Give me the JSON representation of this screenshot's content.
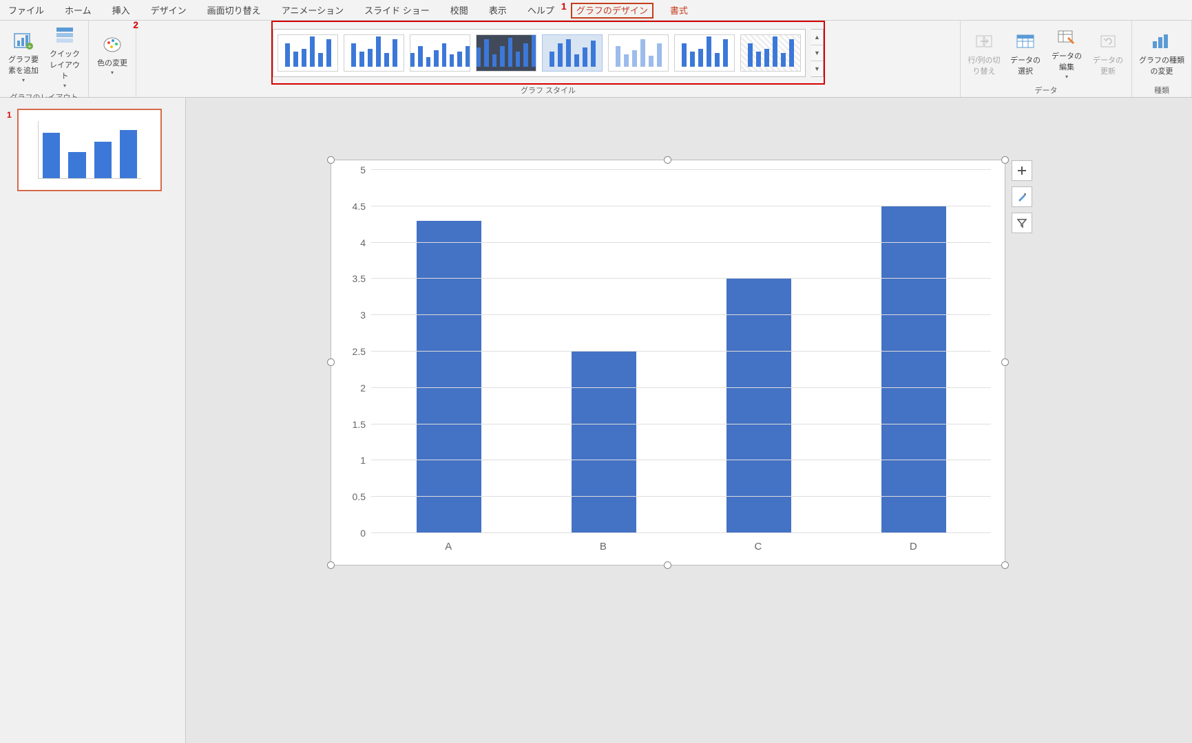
{
  "tabs": {
    "file": "ファイル",
    "home": "ホーム",
    "insert": "挿入",
    "design": "デザイン",
    "transitions": "画面切り替え",
    "animations": "アニメーション",
    "slideshow": "スライド ショー",
    "review": "校閲",
    "view": "表示",
    "help": "ヘルプ",
    "chart_design": "グラフのデザイン",
    "format": "書式"
  },
  "annotations": {
    "one": "1",
    "two": "2"
  },
  "ribbon": {
    "layout": {
      "add_element": "グラフ要素を追加",
      "quick_layout": "クイックレイアウト",
      "group_label": "グラフのレイアウト"
    },
    "colors": {
      "change_colors": "色の変更"
    },
    "styles": {
      "group_label": "グラフ スタイル"
    },
    "data": {
      "switch": "行/列の切り替え",
      "select": "データの選択",
      "edit": "データの編集",
      "refresh": "データの更新",
      "group_label": "データ"
    },
    "type": {
      "change_type": "グラフの種類の変更",
      "group_label": "種類"
    }
  },
  "thumbs": {
    "slide1": "1"
  },
  "chart_data": {
    "type": "bar",
    "categories": [
      "A",
      "B",
      "C",
      "D"
    ],
    "values": [
      4.3,
      2.5,
      3.5,
      4.5
    ],
    "ylim": [
      0,
      5
    ],
    "ystep": 0.5,
    "yticks": [
      "0",
      "0.5",
      "1",
      "1.5",
      "2",
      "2.5",
      "3",
      "3.5",
      "4",
      "4.5",
      "5"
    ],
    "title": "",
    "xlabel": "",
    "ylabel": ""
  },
  "gallery": {
    "styles": [
      {
        "bars": [
          34,
          22,
          26,
          44,
          20,
          40
        ]
      },
      {
        "bars": [
          34,
          22,
          26,
          44,
          20,
          40
        ]
      },
      {
        "bars": [
          20,
          30,
          14,
          24,
          34,
          18,
          22,
          30
        ]
      },
      {
        "bars": [
          28,
          40,
          18,
          30,
          42,
          22,
          34,
          46
        ],
        "dark": true
      },
      {
        "bars": [
          22,
          34,
          40,
          18,
          28,
          38
        ],
        "sel": true
      },
      {
        "bars": [
          30,
          18,
          24,
          40,
          16,
          34
        ],
        "faded": true
      },
      {
        "bars": [
          34,
          22,
          26,
          44,
          20,
          40
        ]
      },
      {
        "bars": [
          34,
          22,
          26,
          44,
          20,
          40
        ],
        "hatch": true
      }
    ]
  }
}
